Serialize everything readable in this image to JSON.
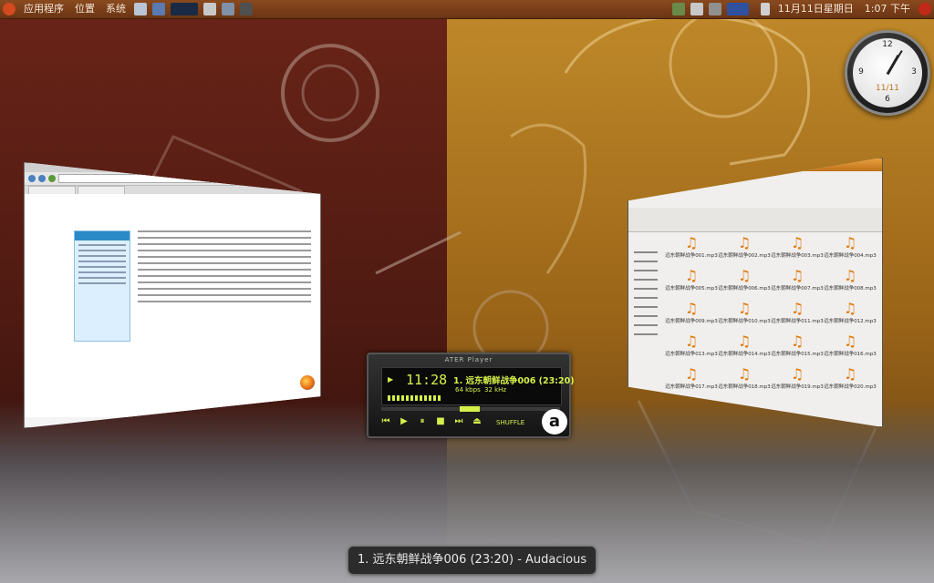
{
  "panel": {
    "menu": [
      "应用程序",
      "位置",
      "系统"
    ],
    "datetime": "11月11日星期日",
    "time": "1:07 下午"
  },
  "clock": {
    "numerals": [
      "12",
      "3",
      "6",
      "9"
    ],
    "date": "11/11"
  },
  "player": {
    "title": "ATER Player",
    "time": "11:28",
    "song": "1. 远东朝鲜战争006 (23:20)",
    "bitrate": "64  kbps",
    "samplerate": "32  kHz",
    "shuffle": "SHUFFLE",
    "logo": "a",
    "controls": [
      "prev",
      "play",
      "pause",
      "stop",
      "next",
      "eject"
    ]
  },
  "files": {
    "items": [
      "远东朝鲜战争001.mp3",
      "远东朝鲜战争002.mp3",
      "远东朝鲜战争003.mp3",
      "远东朝鲜战争004.mp3",
      "远东朝鲜战争005.mp3",
      "远东朝鲜战争006.mp3",
      "远东朝鲜战争007.mp3",
      "远东朝鲜战争008.mp3",
      "远东朝鲜战争009.mp3",
      "远东朝鲜战争010.mp3",
      "远东朝鲜战争011.mp3",
      "远东朝鲜战争012.mp3",
      "远东朝鲜战争013.mp3",
      "远东朝鲜战争014.mp3",
      "远东朝鲜战争015.mp3",
      "远东朝鲜战争016.mp3",
      "远东朝鲜战争017.mp3",
      "远东朝鲜战争018.mp3",
      "远东朝鲜战争019.mp3",
      "远东朝鲜战争020.mp3"
    ]
  },
  "tooltip": "1. 远东朝鲜战争006 (23:20) - Audacious",
  "colors": {
    "panel": "#7a3e18",
    "lcd_text": "#d6f04a",
    "bg_left": "#5a1e14",
    "bg_right": "#b07820"
  }
}
